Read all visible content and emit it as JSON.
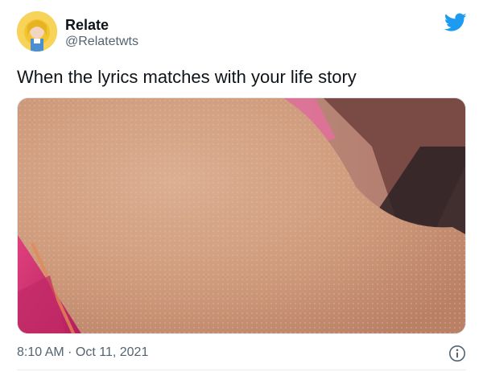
{
  "tweet": {
    "display_name": "Relate",
    "handle": "@Relatetwts",
    "text": "When the lyrics matches with your life story",
    "timestamp": "8:10 AM · Oct 11, 2021"
  },
  "icons": {
    "brand": "twitter-bird-icon",
    "info": "info-icon"
  },
  "colors": {
    "twitter_blue": "#1d9bf0",
    "secondary_text": "#536471",
    "primary_text": "#0f1419"
  }
}
